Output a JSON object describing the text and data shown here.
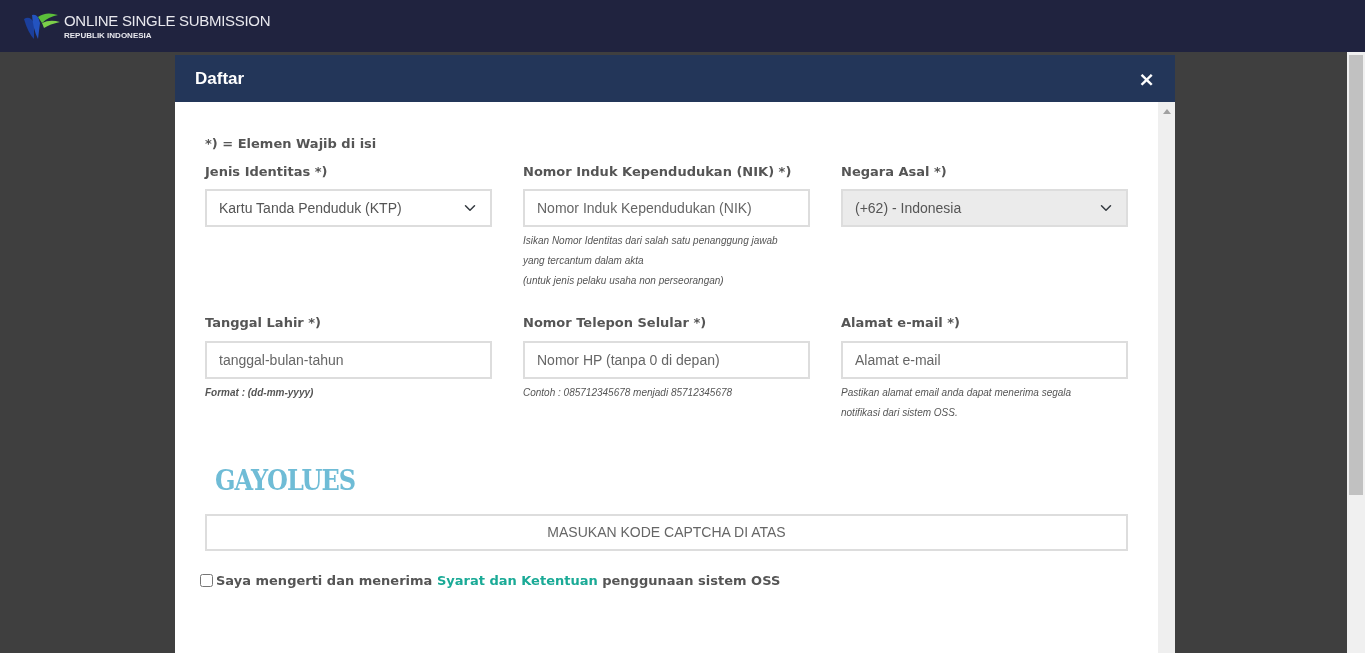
{
  "header": {
    "title": "ONLINE SINGLE SUBMISSION",
    "subtitle": "REPUBLIK INDONESIA"
  },
  "modal": {
    "title": "Daftar",
    "close": "×"
  },
  "required_note": "*) = Elemen Wajib di isi",
  "fields": [
    {
      "kind": "select",
      "label": "Jenis Identitas *)",
      "value": "Kartu Tanda Penduduk (KTP)",
      "disabled": false
    },
    {
      "kind": "input",
      "label": "Nomor Induk Kependudukan (NIK) *)",
      "placeholder": "Nomor Induk Kependudukan (NIK)",
      "disabled": false,
      "help": [
        {
          "kind": "note",
          "text": "Isikan Nomor Identitas dari salah satu penanggung jawab"
        },
        {
          "kind": "note",
          "text": "yang tercantum dalam akta"
        },
        {
          "kind": "note",
          "text": "(untuk jenis pelaku usaha non perseorangan)"
        }
      ]
    },
    {
      "kind": "select",
      "label": "Negara Asal *)",
      "value": "(+62) - Indonesia",
      "disabled": true
    },
    {
      "kind": "input",
      "label": "Tanggal Lahir *)",
      "placeholder": "tanggal-bulan-tahun",
      "disabled": false,
      "help": [
        {
          "kind": "format",
          "text": "Format : (dd-mm-yyyy)"
        }
      ]
    },
    {
      "kind": "input",
      "label": "Nomor Telepon Selular *)",
      "placeholder": "Nomor HP (tanpa 0 di depan)",
      "disabled": false,
      "help": [
        {
          "kind": "note",
          "text": "Contoh : 085712345678 menjadi 85712345678"
        }
      ]
    },
    {
      "kind": "input",
      "label": "Alamat e-mail *)",
      "placeholder": "Alamat e-mail",
      "disabled": false,
      "help": [
        {
          "kind": "note",
          "text": "Pastikan alamat email anda dapat menerima segala"
        },
        {
          "kind": "note",
          "text": "notifikasi dari sistem OSS."
        }
      ]
    }
  ],
  "captcha": {
    "image_text": "GAYOLUES",
    "placeholder": "MASUKAN KODE CAPTCHA DI ATAS"
  },
  "agreement": {
    "checked": false,
    "before": "Saya mengerti dan menerima",
    "link": "Syarat dan Ketentuan",
    "after": "penggunaan sistem OSS"
  }
}
